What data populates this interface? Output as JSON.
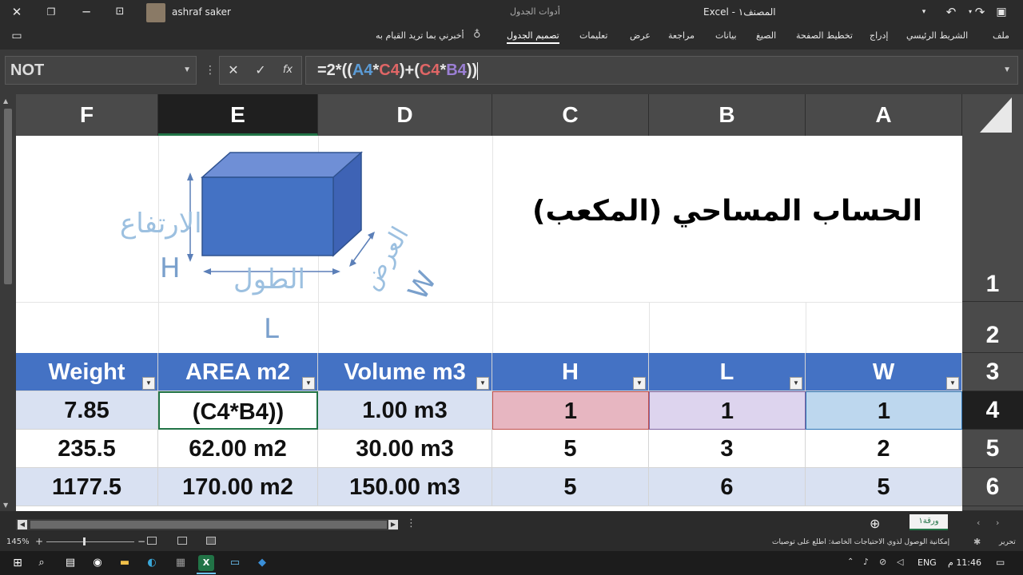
{
  "titlebar": {
    "user_name": "ashraf saker",
    "app_title": "Excel",
    "book_title": "المصنف١",
    "title_separator": "-",
    "context_group": "أدوات الجدول"
  },
  "ribbon": {
    "tabs": [
      "ملف",
      "الشريط الرئيسي",
      "إدراج",
      "تخطيط الصفحة",
      "الصيغ",
      "بيانات",
      "مراجعة",
      "عرض",
      "تعليمات",
      "تصميم الجدول"
    ],
    "tell_me": "أخبرني بما تريد القيام به"
  },
  "formula_bar": {
    "name_box": "NOT",
    "formula_parts": [
      "=2*((",
      "A4",
      "*",
      "C4",
      ")+(",
      "C4",
      "*",
      "B4",
      "))"
    ]
  },
  "columns": [
    "F",
    "E",
    "D",
    "C",
    "B",
    "A"
  ],
  "rows": [
    "1",
    "2",
    "3",
    "4",
    "5",
    "6"
  ],
  "diagram": {
    "title": "الحساب المساحي (المكعب)",
    "height_label": "الارتفاع",
    "height_letter": "H",
    "length_label": "الطول",
    "length_letter": "L",
    "width_label": "العرض",
    "width_letter": "W"
  },
  "table": {
    "headers": [
      "Weight",
      "AREA m2",
      "Volume m3",
      "H",
      "L",
      "W"
    ],
    "rows": [
      [
        "7.85",
        "(C4*B4))",
        "1.00 m3",
        "1",
        "1",
        "1"
      ],
      [
        "235.5",
        "62.00 m2",
        "30.00 m3",
        "5",
        "3",
        "2"
      ],
      [
        "1177.5",
        "170.00 m2",
        "150.00 m3",
        "5",
        "6",
        "5"
      ]
    ]
  },
  "status": {
    "sheet_tab": "ورقة١",
    "mode": "تحرير",
    "accessibility": "إمكانية الوصول لذوي الاحتياجات الخاصة: اطلع على توصيات",
    "zoom": "145%"
  },
  "taskbar": {
    "lang": "ENG",
    "time": "11:46 م"
  },
  "colors": {
    "table_header": "#4472c4",
    "band": "#d9e1f2",
    "cube_front": "#4472c4",
    "ref_a4": "#2e75b6",
    "ref_c4": "#c0504d",
    "ref_b4": "#7b5ea7"
  }
}
